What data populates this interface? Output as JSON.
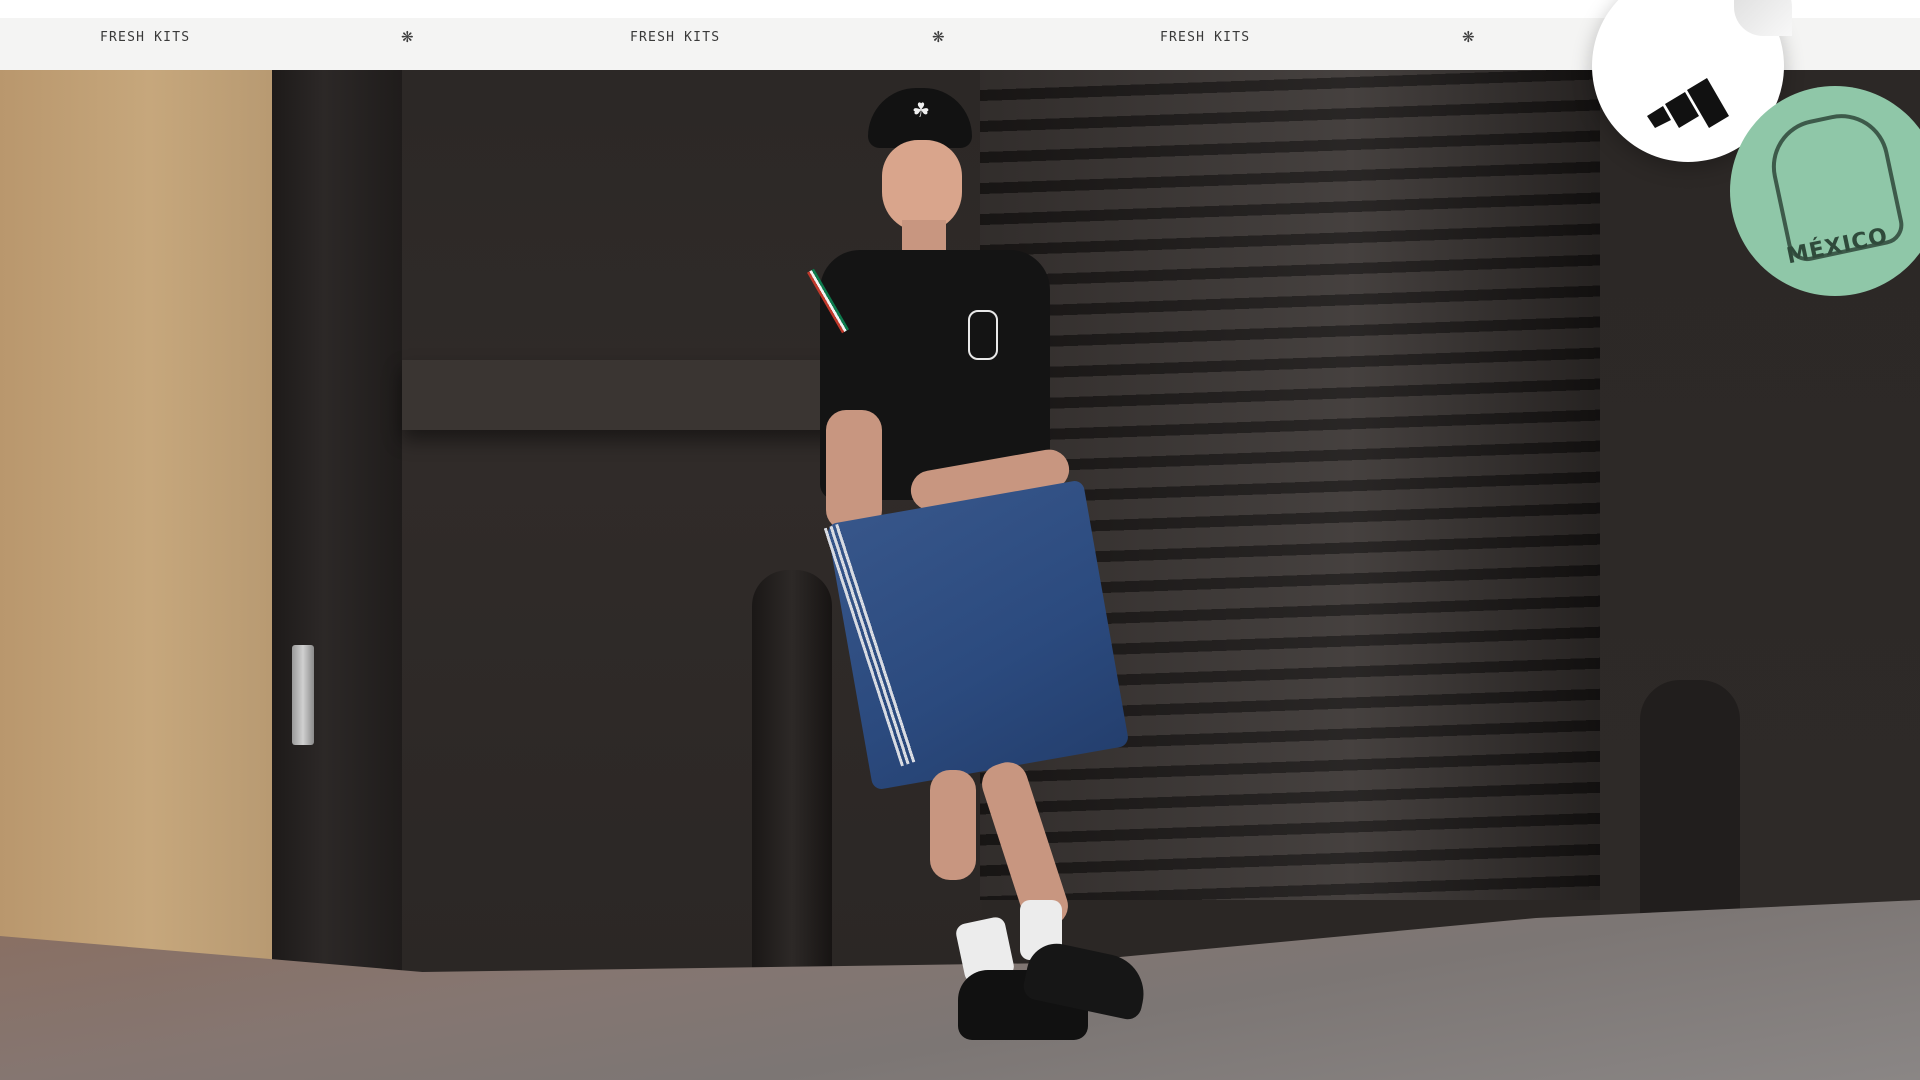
{
  "ticker": {
    "items": [
      {
        "label": "FRESH KITS",
        "separator": "❋"
      },
      {
        "label": "FRESH KITS",
        "separator": "❋"
      },
      {
        "label": "FRESH KITS",
        "separator": "❋"
      }
    ]
  },
  "hero": {
    "cap_logo": "☘"
  },
  "stickers": {
    "brand_icon": "adidas-performance-logo-icon",
    "badge_text": "MÉXICO",
    "badge_color": "#8fc7a8"
  },
  "colors": {
    "ticker_bg": "#f4f4f3",
    "ticker_text": "#3a3a3a",
    "jersey_green": "#0d7a4d",
    "jersey_red": "#c0392b"
  }
}
